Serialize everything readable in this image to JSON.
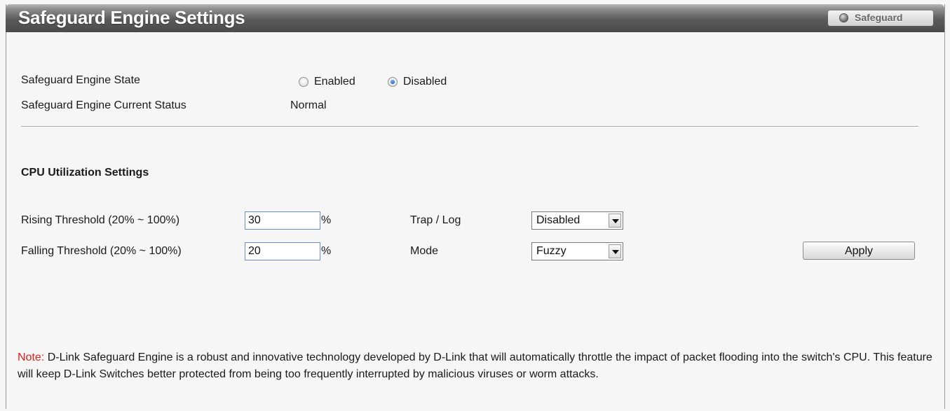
{
  "header": {
    "title": "Safeguard Engine Settings",
    "badge_label": "Safeguard"
  },
  "engine": {
    "state_label": "Safeguard Engine State",
    "state_options": [
      {
        "label": "Enabled",
        "selected": false
      },
      {
        "label": "Disabled",
        "selected": true
      }
    ],
    "status_label": "Safeguard Engine Current Status",
    "status_value": "Normal"
  },
  "cpu": {
    "section_title": "CPU Utilization Settings",
    "rising_label": "Rising Threshold (20% ~ 100%)",
    "rising_value": "30",
    "falling_label": "Falling Threshold (20% ~ 100%)",
    "falling_value": "20",
    "unit": "%",
    "trap_label": "Trap / Log",
    "trap_value": "Disabled",
    "mode_label": "Mode",
    "mode_value": "Fuzzy",
    "apply_label": "Apply"
  },
  "note": {
    "prefix": "Note:",
    "text": " D-Link Safeguard Engine is a robust and innovative technology developed by D-Link that will automatically throttle the impact of packet flooding into the switch's CPU. This feature will keep D-Link Switches better protected from being too frequently interrupted by malicious viruses or worm attacks."
  },
  "colors": {
    "note_prefix": "#e0201b",
    "title_bar": "#5a5a5a",
    "radio_selected": "#0a4fa8"
  }
}
